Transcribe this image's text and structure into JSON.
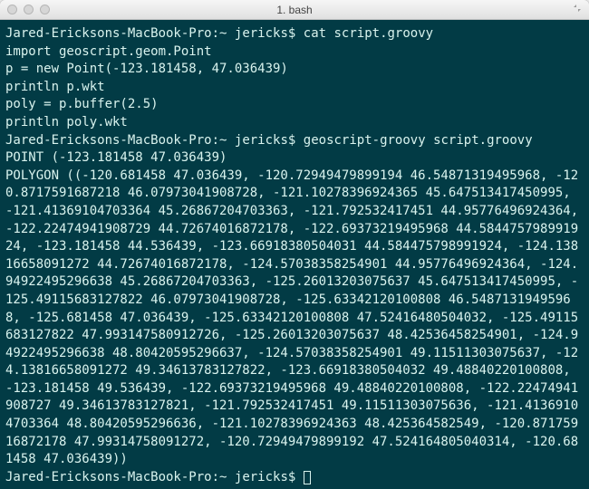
{
  "window": {
    "title": "1. bash"
  },
  "prompt": {
    "host": "Jared-Ericksons-MacBook-Pro",
    "path": "~",
    "user": "jericks",
    "symbol": "$"
  },
  "commands": {
    "cat": "cat script.groovy",
    "run": "geoscript-groovy script.groovy",
    "idle": ""
  },
  "script": {
    "l1": "import geoscript.geom.Point",
    "l2": "",
    "l3": "p = new Point(-123.181458, 47.036439)",
    "l4": "println p.wkt",
    "l5": "",
    "l6": "poly = p.buffer(2.5)",
    "l7": "println poly.wkt"
  },
  "output": {
    "point": "POINT (-123.181458 47.036439)",
    "polygon": "POLYGON ((-120.681458 47.036439, -120.72949479899194 46.54871319495968, -120.8717591687218 46.07973041908728, -121.10278396924365 45.647513417450995, -121.41369104703364 45.26867204703363, -121.792532417451 44.95776496924364, -122.22474941908729 44.72674016872178, -122.69373219495968 44.584475798991924, -123.181458 44.536439, -123.66918380504031 44.58447579899192​4, -124.13816658091272 44.7267401687​2178, -124.57038358254901 44.95776496924364, -124.94922495296638 45.26867204703363, -125.26013203075637 45.647513417450995, -125.49115683127822 46.07973041908728, -125.63342120100808 46.54871319495968, -125.681458 47.036439, -125.63342120100808 47.52416480504032, -125.49115683127822 47.993147580912726, -125.26013203075637 48.42536458254901, -124.94922495296638 48.80420595296637, -124.570383582549​01 49.11511303075637, -124.13816658091272 49.346​13783127822, -123.66918380504032 49.48840220100808, -123.181458 49.536439, -122.69373219495968 49.48840220100808, -122.22474941908727 49.346137831278​21, -121.792532417451 49.11511303075636, -121.41369104703364 48.80420595296636, -121.10278396924363 48.425364582549, -120.87175916872178 47.993147580912​72, -120.72949479899192 47.524164805040314, -120.681458 47.036439))"
  }
}
